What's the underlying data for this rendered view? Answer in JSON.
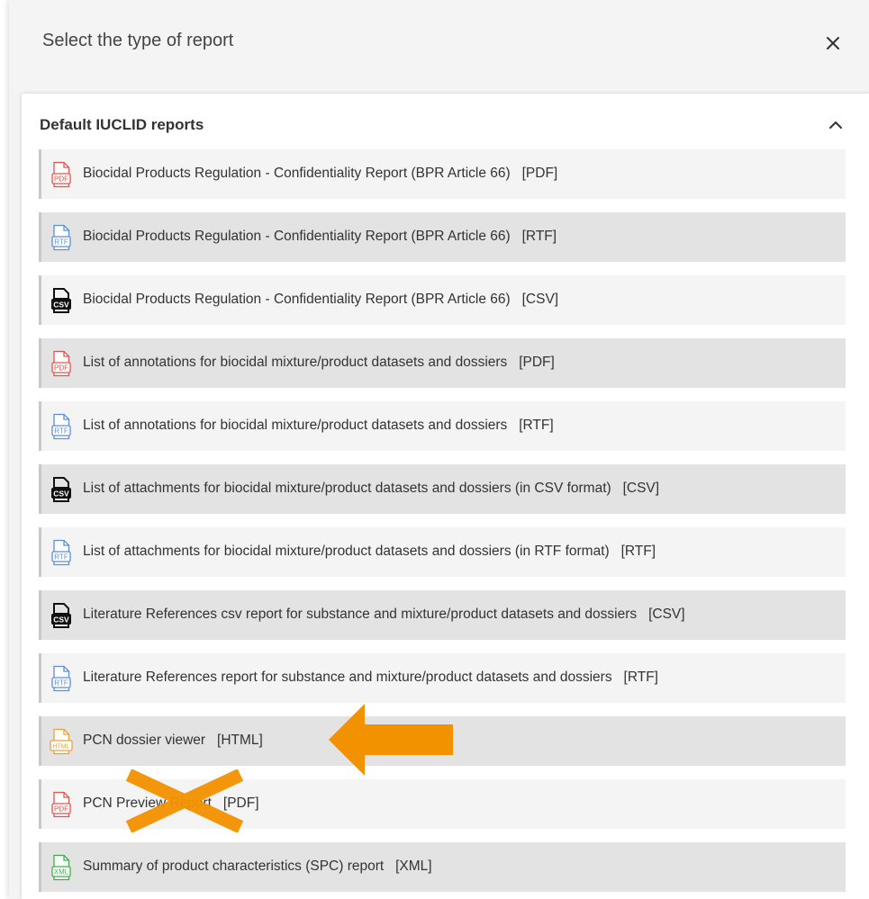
{
  "dialog": {
    "title": "Select the type of report",
    "close_icon": "close-icon"
  },
  "section": {
    "title": "Default IUCLID reports",
    "toggle_icon": "chevron-up-icon"
  },
  "items": [
    {
      "label": "Biocidal Products Regulation - Confidentiality Report (BPR Article 66)   [PDF]",
      "format": "PDF",
      "icon": "pdf-file-icon"
    },
    {
      "label": "Biocidal Products Regulation - Confidentiality Report (BPR Article 66)   [RTF]",
      "format": "RTF",
      "icon": "rtf-file-icon"
    },
    {
      "label": "Biocidal Products Regulation - Confidentiality Report (BPR Article 66)   [CSV]",
      "format": "CSV",
      "icon": "csv-file-icon"
    },
    {
      "label": "List of annotations for biocidal mixture/product datasets and dossiers   [PDF]",
      "format": "PDF",
      "icon": "pdf-file-icon"
    },
    {
      "label": "List of annotations for biocidal mixture/product datasets and dossiers   [RTF]",
      "format": "RTF",
      "icon": "rtf-file-icon"
    },
    {
      "label": "List of attachments for biocidal mixture/product datasets and dossiers (in CSV format)   [CSV]",
      "format": "CSV",
      "icon": "csv-file-icon"
    },
    {
      "label": "List of attachments for biocidal mixture/product datasets and dossiers (in RTF format)   [RTF]",
      "format": "RTF",
      "icon": "rtf-file-icon"
    },
    {
      "label": "Literature References csv report for substance and mixture/product datasets and dossiers   [CSV]",
      "format": "CSV",
      "icon": "csv-file-icon"
    },
    {
      "label": "Literature References report for substance and mixture/product datasets and dossiers   [RTF]",
      "format": "RTF",
      "icon": "rtf-file-icon"
    },
    {
      "label": "PCN dossier viewer   [HTML]",
      "format": "HTML",
      "icon": "html-file-icon"
    },
    {
      "label": "PCN Preview Report   [PDF]",
      "format": "PDF",
      "icon": "pdf-file-icon"
    },
    {
      "label": "Summary of product characteristics (SPC) report   [XML]",
      "format": "XML",
      "icon": "xml-file-icon"
    }
  ],
  "colors": {
    "PDF": "#e0544e",
    "RTF": "#5b8fd9",
    "CSV": "#111111",
    "HTML": "#e8a23a",
    "XML": "#3fae49",
    "annotation": "#f39200"
  },
  "annotations": {
    "arrow_icon": "arrow-left-icon",
    "cross_icon": "cross-out-icon"
  }
}
